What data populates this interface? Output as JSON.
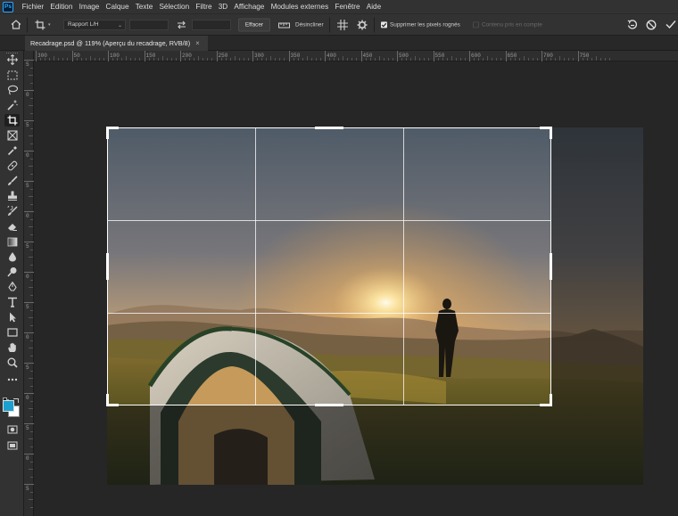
{
  "app": {
    "logo": "Ps"
  },
  "menu": [
    "Fichier",
    "Edition",
    "Image",
    "Calque",
    "Texte",
    "Sélection",
    "Filtre",
    "3D",
    "Affichage",
    "Modules externes",
    "Fenêtre",
    "Aide"
  ],
  "options_bar": {
    "ratio_select": "Rapport L/H",
    "width_value": "",
    "height_value": "",
    "clear_button": "Effacer",
    "straighten_label": "Désincliner",
    "delete_cropped_label": "Supprimer les pixels rognés",
    "delete_cropped_checked": true,
    "content_aware_label": "Contenu pris en compte",
    "content_aware_checked": false
  },
  "document_tab": {
    "title": "Recadrage.psd @ 119% (Aperçu du recadrage, RVB/8)",
    "close": "×"
  },
  "ruler": {
    "horizontal_ticks": [
      "300",
      "50",
      "100",
      "150",
      "200",
      "250",
      "300",
      "350",
      "400",
      "450",
      "500",
      "550",
      "600",
      "650",
      "700",
      "750"
    ],
    "vertical_ticks": [
      "5",
      "0",
      "5",
      "0",
      "5",
      "0",
      "5",
      "0",
      "5",
      "0",
      "5",
      "0",
      "5",
      "0",
      "5",
      "0"
    ]
  },
  "colors": {
    "foreground": "#1aa0d0",
    "background": "#ffffff",
    "ui_dark": "#262626",
    "ui_panel": "#323232"
  },
  "tools": [
    "move-tool",
    "marquee-tool",
    "lasso-tool",
    "magic-wand-tool",
    "crop-tool",
    "frame-tool",
    "eyedropper-tool",
    "healing-brush-tool",
    "brush-tool",
    "clone-stamp-tool",
    "history-brush-tool",
    "eraser-tool",
    "gradient-tool",
    "blur-tool",
    "dodge-tool",
    "pen-tool",
    "type-tool",
    "path-selection-tool",
    "rectangle-tool",
    "hand-tool",
    "zoom-tool",
    "more-tools",
    "quick-mask-tool",
    "screen-mode-tool"
  ]
}
